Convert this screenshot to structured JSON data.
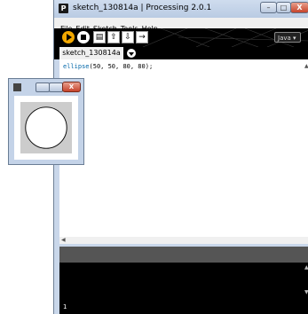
{
  "app": {
    "title": "sketch_130814a | Processing 2.0.1",
    "icon_letter": "P",
    "window_controls": {
      "minimize": "–",
      "maximize": "□",
      "close": "X"
    }
  },
  "menu": [
    "File",
    "Edit",
    "Sketch",
    "Tools",
    "Help"
  ],
  "toolbar": {
    "buttons": [
      "run-icon",
      "stop-icon",
      "new-icon",
      "open-icon",
      "save-icon",
      "export-icon"
    ],
    "new_glyph": "▤",
    "open_glyph": "⇧",
    "save_glyph": "⇩",
    "export_glyph": "→",
    "mode": "Java ▾"
  },
  "tabs": [
    {
      "label": "sketch_130814a",
      "active": true
    }
  ],
  "editor": {
    "keyword": "ellipse",
    "code_rest": "(50, 50, 80, 80);"
  },
  "status": {
    "line_number": "1"
  },
  "sketch_window": {
    "close_label": "X"
  },
  "colors": {
    "run_button": "#f3a800",
    "toolbar_bg": "#000000",
    "keyword": "#0066a8",
    "console_bg": "#000000",
    "status_bg": "#555555",
    "canvas_bg": "#cccccc",
    "ellipse_fill": "#ffffff"
  }
}
